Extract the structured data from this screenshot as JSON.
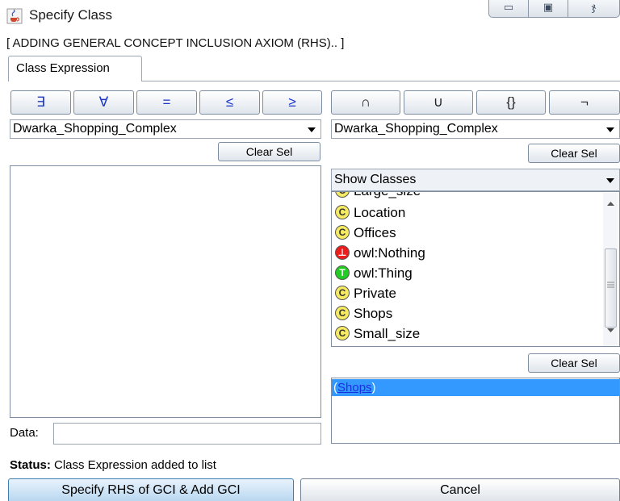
{
  "window": {
    "title": "Specify Class",
    "controls": {
      "minimize": "▭",
      "maximize": "▣",
      "close": "ჯ"
    }
  },
  "subtitle": "[ ADDING GENERAL CONCEPT INCLUSION AXIOM (RHS).. ]",
  "tab": {
    "label": "Class Expression"
  },
  "left": {
    "operators": [
      "∃",
      "∀",
      "=",
      "≤",
      "≥"
    ],
    "combo_value": "Dwarka_Shopping_Complex",
    "clear_label": "Clear Sel",
    "data_label": "Data:",
    "data_value": ""
  },
  "right": {
    "operators": [
      "∩",
      "∪",
      "{}",
      "¬"
    ],
    "combo_value": "Dwarka_Shopping_Complex",
    "clear_label": "Clear Sel",
    "show_combo": "Show Classes",
    "classes": [
      {
        "name": "Large_size",
        "icon": "C"
      },
      {
        "name": "Location",
        "icon": "C"
      },
      {
        "name": "Offices",
        "icon": "C"
      },
      {
        "name": "owl:Nothing",
        "icon": "⊥"
      },
      {
        "name": "owl:Thing",
        "icon": "T"
      },
      {
        "name": "Private",
        "icon": "C"
      },
      {
        "name": "Shops",
        "icon": "C"
      },
      {
        "name": "Small_size",
        "icon": "C"
      }
    ],
    "clear_label_2": "Clear Sel",
    "expression_open": "(",
    "expression_link": "Shops",
    "expression_close": ")"
  },
  "status": {
    "label": "Status:",
    "text": " Class Expression added to list"
  },
  "buttons": {
    "specify": "Specify RHS of GCI & Add GCI",
    "cancel": "Cancel"
  },
  "colors": {
    "selection": "#3399ff",
    "link": "#1a2fe0",
    "operator_blue": "#1a35c8"
  }
}
